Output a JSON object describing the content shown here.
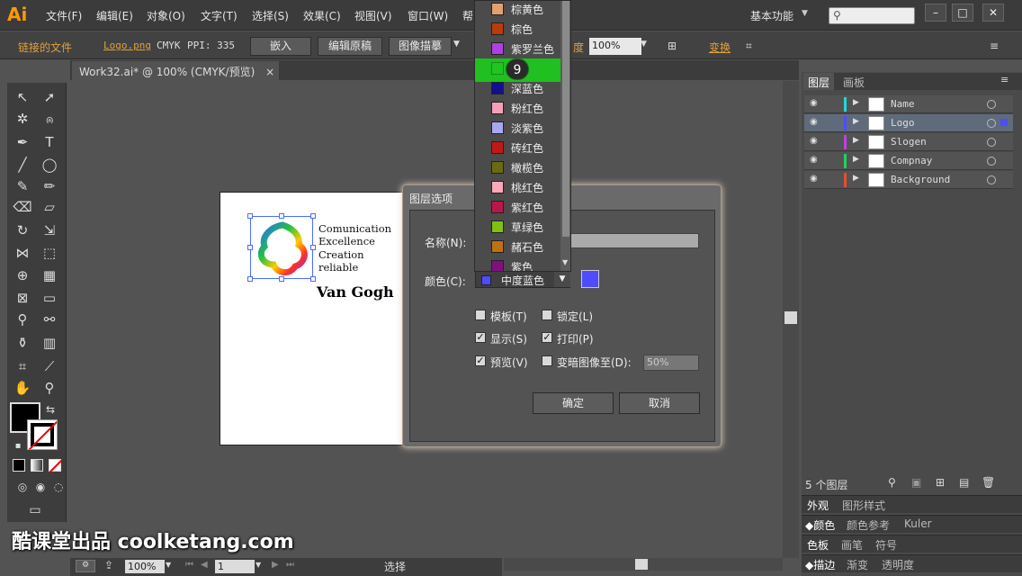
{
  "app": {
    "logo": "Ai"
  },
  "menu": [
    "文件(F)",
    "编辑(E)",
    "对象(O)",
    "文字(T)",
    "选择(S)",
    "效果(C)",
    "视图(V)",
    "窗口(W)",
    "帮"
  ],
  "workspace": "基本功能",
  "controlbar": {
    "linked_file": "链接的文件",
    "file_name": "Logo.png",
    "color_mode": "CMYK",
    "ppi": "PPI: 335",
    "embed": "嵌入",
    "edit_original": "编辑原稿",
    "image_trace": "图像描摹",
    "opacity_label": "度",
    "opacity_value": "100%",
    "transform": "变换"
  },
  "document_tab": {
    "title": "Work32.ai* @ 100% (CMYK/预览)",
    "close": "×"
  },
  "artwork": {
    "slogan_lines": [
      "Comunication",
      "Excellence",
      "Creation",
      "reliable"
    ],
    "brand": "Van Gogh"
  },
  "dialog": {
    "title": "图层选项",
    "name_label": "名称(N):",
    "color_label": "颜色(C):",
    "color_value": "中度蓝色",
    "color_hex": "#4d4dff",
    "options": [
      {
        "label": "模板(T)",
        "checked": false
      },
      {
        "label": "锁定(L)",
        "checked": false
      },
      {
        "label": "显示(S)",
        "checked": true
      },
      {
        "label": "打印(P)",
        "checked": true
      },
      {
        "label": "预览(V)",
        "checked": true
      },
      {
        "label": "变暗图像至(D):",
        "checked": false
      }
    ],
    "dim_value": "50%",
    "ok": "确定",
    "cancel": "取消"
  },
  "color_dropdown": {
    "items": [
      {
        "label": "棕黄色",
        "color": "#e0a070"
      },
      {
        "label": "棕色",
        "color": "#b83c10"
      },
      {
        "label": "紫罗兰色",
        "color": "#b040e0"
      },
      {
        "label": "",
        "color": "#22c422",
        "highlighted": true
      },
      {
        "label": "深蓝色",
        "color": "#101090"
      },
      {
        "label": "粉红色",
        "color": "#f4a0b8"
      },
      {
        "label": "淡紫色",
        "color": "#a8a8f0"
      },
      {
        "label": "砖红色",
        "color": "#c01818"
      },
      {
        "label": "橄榄色",
        "color": "#6a6a10"
      },
      {
        "label": "桃红色",
        "color": "#f8a8b8"
      },
      {
        "label": "紫红色",
        "color": "#b81848"
      },
      {
        "label": "草绿色",
        "color": "#80c010"
      },
      {
        "label": "赭石色",
        "color": "#c07010"
      },
      {
        "label": "紫色",
        "color": "#801080"
      }
    ],
    "step_badge": "9"
  },
  "layers_panel": {
    "tabs": [
      "图层",
      "画板"
    ],
    "layers": [
      {
        "name": "Name",
        "color": "#22d8d8",
        "selected": false
      },
      {
        "name": "Logo",
        "color": "#4d4dff",
        "selected": true
      },
      {
        "name": "Slogen",
        "color": "#c040e0",
        "selected": false
      },
      {
        "name": "Compnay",
        "color": "#22d060",
        "selected": false
      },
      {
        "name": "Background",
        "color": "#e05030",
        "selected": false
      }
    ],
    "count": "5 个图层"
  },
  "sub_panels": [
    {
      "tabs": [
        "外观",
        "图形样式"
      ]
    },
    {
      "tabs": [
        "◆颜色",
        "颜色参考",
        "Kuler"
      ]
    },
    {
      "tabs": [
        "色板",
        "画笔",
        "符号"
      ]
    },
    {
      "tabs": [
        "◆描边",
        "渐变",
        "透明度"
      ]
    }
  ],
  "statusbar": {
    "zoom": "100%",
    "page": "1",
    "tool": "选择"
  },
  "watermark": "酷课堂出品 coolketang.com"
}
